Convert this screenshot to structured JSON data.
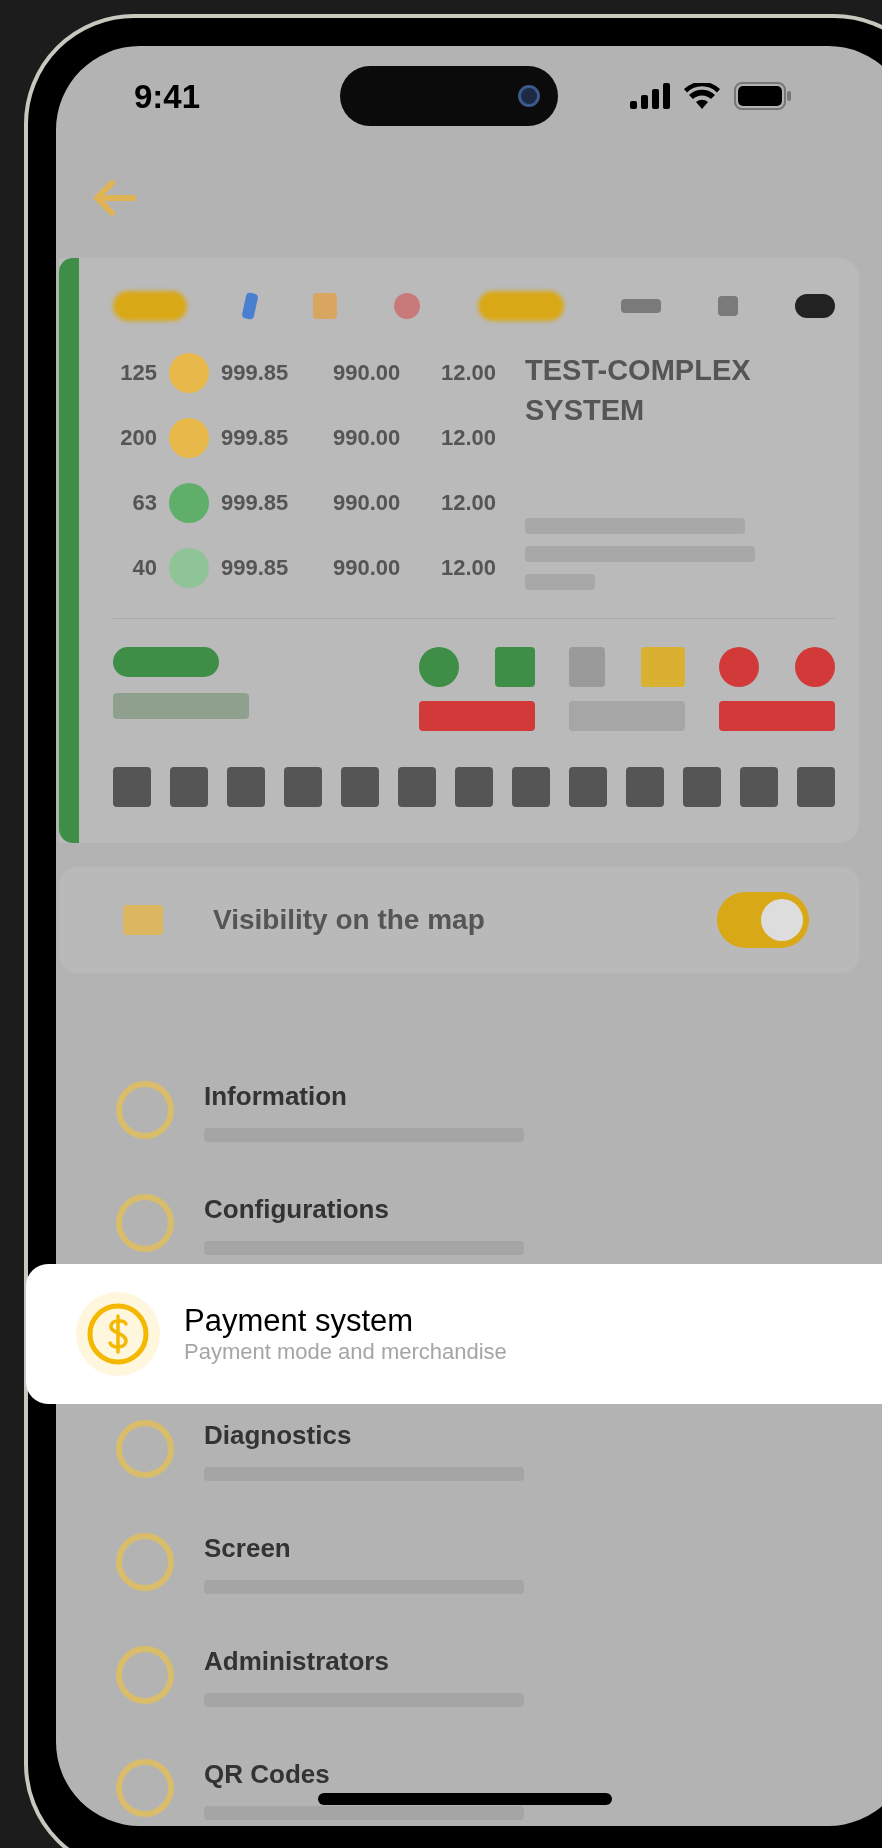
{
  "status_bar": {
    "time": "9:41"
  },
  "station_card": {
    "title": "TEST-COMPLEX SYSTEM",
    "rows": [
      {
        "power": "125",
        "color": "#e8b84a",
        "price_1": "999.85",
        "price_2": "990.00",
        "price_3": "12.00"
      },
      {
        "power": "200",
        "color": "#e8b84a",
        "price_1": "999.85",
        "price_2": "990.00",
        "price_3": "12.00"
      },
      {
        "power": "63",
        "color": "#5fae6a",
        "price_1": "999.85",
        "price_2": "990.00",
        "price_3": "12.00"
      },
      {
        "power": "40",
        "color": "#8fc596",
        "price_1": "999.85",
        "price_2": "990.00",
        "price_3": "12.00"
      }
    ]
  },
  "visibility": {
    "label": "Visibility on the map",
    "on": true
  },
  "menu": [
    {
      "kind": "item",
      "title": "Information"
    },
    {
      "kind": "item",
      "title": "Configurations"
    },
    {
      "kind": "highlighted",
      "title": "Payment system",
      "subtitle": "Payment mode and merchandise"
    },
    {
      "kind": "item",
      "title": "Diagnostics"
    },
    {
      "kind": "item",
      "title": "Screen"
    },
    {
      "kind": "item",
      "title": "Administrators"
    },
    {
      "kind": "item",
      "title": "QR Codes"
    }
  ]
}
